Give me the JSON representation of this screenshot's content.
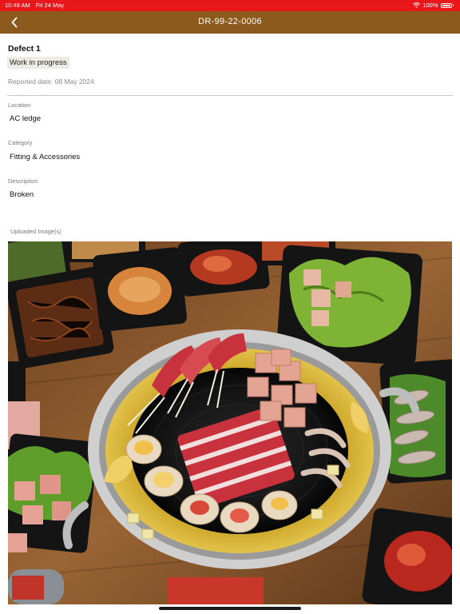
{
  "status_bar": {
    "time": "10:48 AM",
    "date": "Fri 24 May",
    "battery": "100%"
  },
  "header": {
    "title": "DR-99-22-0006",
    "back_icon": "chevron-left-icon"
  },
  "defect": {
    "title": "Defect 1",
    "status": "Work in progress",
    "reported_date": "Reported date: 08 May 2024"
  },
  "fields": {
    "location": {
      "label": "Location",
      "value": "AC ledge"
    },
    "category": {
      "label": "Category",
      "value": "Fitting & Accessories"
    },
    "description": {
      "label": "Description",
      "value": "Broken"
    }
  },
  "uploaded_images": {
    "label": "Uploaded Image(s)"
  },
  "colors": {
    "status_bar": "#e8171c",
    "nav_bar": "#8c5a1c",
    "badge_bg": "#ecebe4"
  }
}
